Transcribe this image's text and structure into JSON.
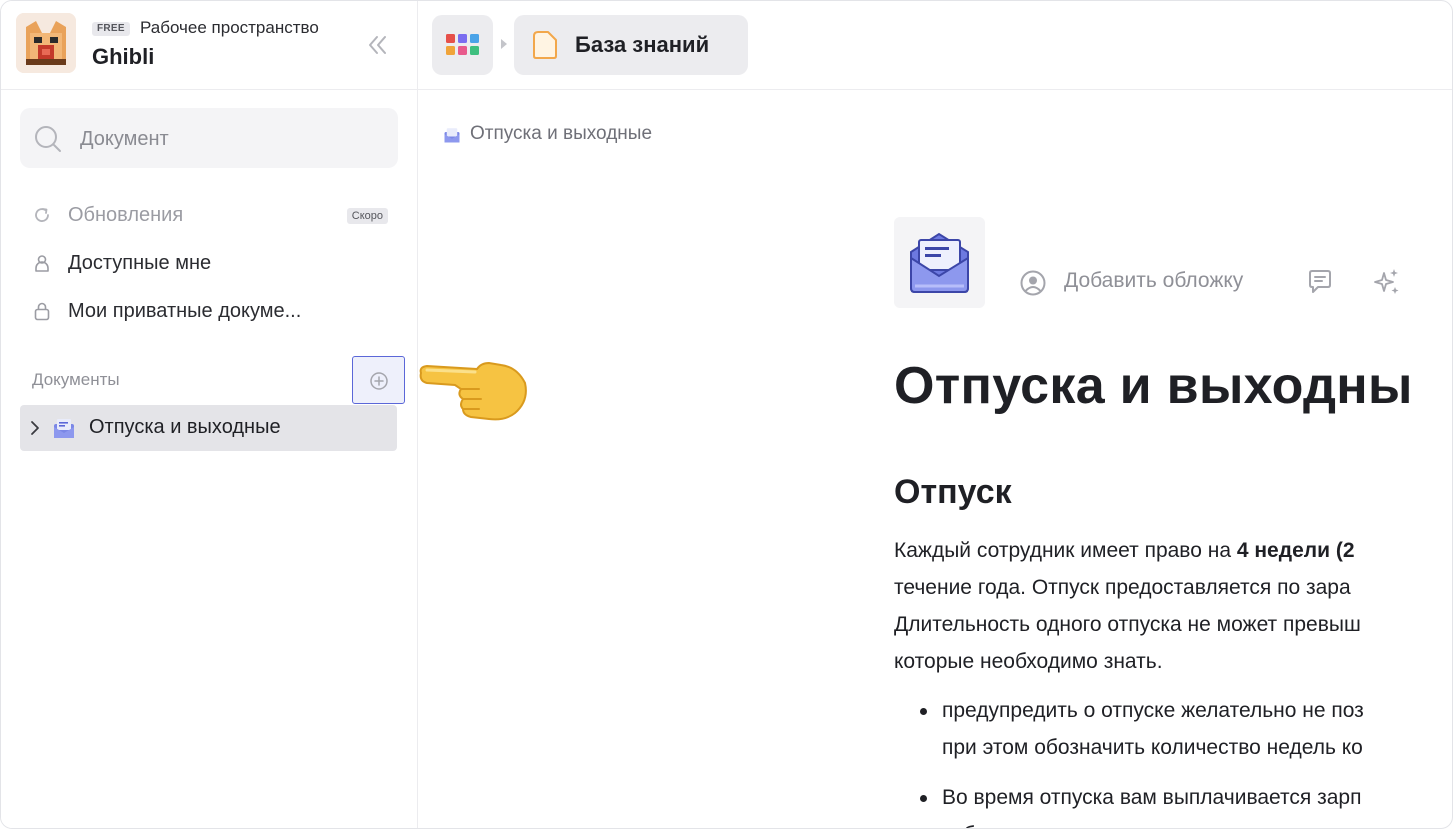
{
  "workspace": {
    "plan_badge": "FREE",
    "label": "Рабочее пространство",
    "name": "Ghibli"
  },
  "sidebar": {
    "search_placeholder": "Документ",
    "nav": [
      {
        "label": "Обновления",
        "icon": "refresh-icon",
        "badge": "Скоро"
      },
      {
        "label": "Доступные мне",
        "icon": "user-icon"
      },
      {
        "label": "Мои приватные докуме...",
        "icon": "lock-icon"
      }
    ],
    "section_title": "Документы",
    "documents": [
      {
        "label": "Отпуска и выходные",
        "icon": "envelope-icon"
      }
    ]
  },
  "topbar": {
    "tab_label": "База знаний"
  },
  "main": {
    "breadcrumb": "Отпуска и выходные",
    "add_cover_label": "Добавить обложку",
    "title": "Отпуска и выходны",
    "heading": "Отпуск",
    "paragraph_lines": [
      {
        "pre": "Каждый сотрудник имеет право на ",
        "bold": "4 недели (2"
      },
      {
        "pre": "течение года. Отпуск предоставляется по зара",
        "bold": ""
      },
      {
        "pre": "Длительность одного отпуска не может превыш",
        "bold": ""
      },
      {
        "pre": "которые необходимо знать.",
        "bold": ""
      }
    ],
    "bullets": [
      [
        "предупредить о отпуске желательно не поз",
        "при этом обозначить количество недель ко"
      ],
      [
        "Во время отпуска вам выплачивается зарп",
        "забронировано"
      ]
    ]
  },
  "colors": {
    "accent": "#5b67d8",
    "sidebar_selected": "#e4e4e8",
    "muted_text": "#8f9097"
  }
}
